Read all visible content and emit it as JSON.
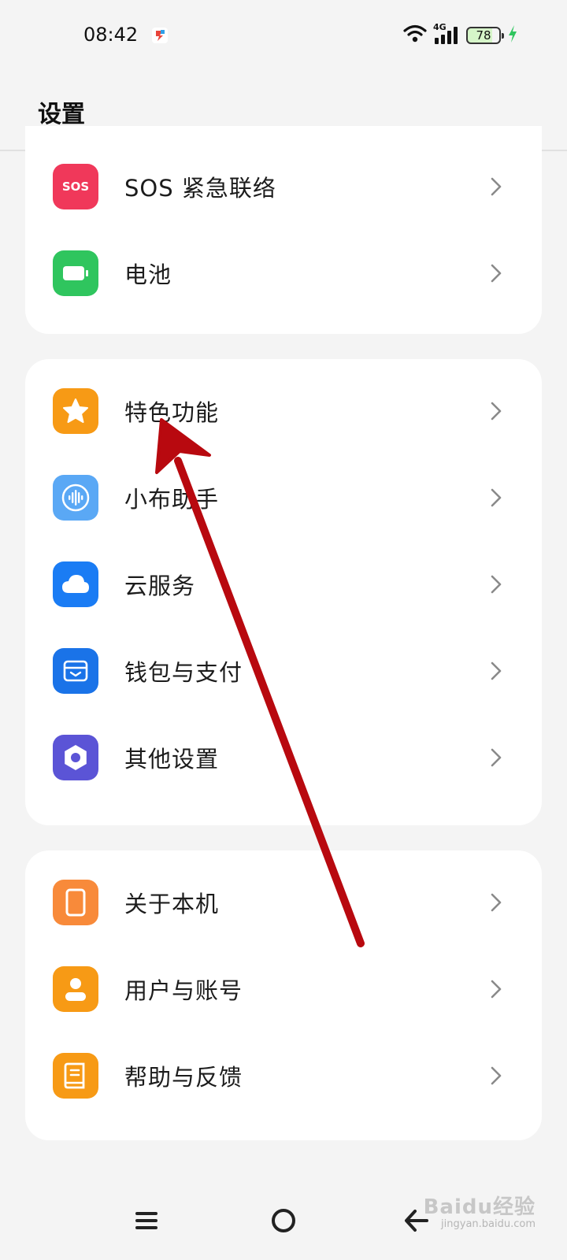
{
  "status_bar": {
    "time": "08:42",
    "network": "4G",
    "battery": "78",
    "charging": true
  },
  "header": {
    "title": "设置"
  },
  "sections": [
    {
      "items": [
        {
          "label": "SOS 紧急联络",
          "icon": "sos-icon",
          "icon_text": "SOS",
          "color": "#f0385a"
        },
        {
          "label": "电池",
          "icon": "battery-icon",
          "color": "#2fc55e"
        }
      ]
    },
    {
      "items": [
        {
          "label": "特色功能",
          "icon": "star-icon",
          "color": "#f79a15"
        },
        {
          "label": "小布助手",
          "icon": "voice-assistant-icon",
          "color": "#5aa8f5"
        },
        {
          "label": "云服务",
          "icon": "cloud-icon",
          "color": "#1a7cf4"
        },
        {
          "label": "钱包与支付",
          "icon": "wallet-icon",
          "color": "#1a73e8"
        },
        {
          "label": "其他设置",
          "icon": "gear-icon",
          "color": "#5b54d6"
        }
      ]
    },
    {
      "items": [
        {
          "label": "关于本机",
          "icon": "phone-icon",
          "color": "#f88a3a"
        },
        {
          "label": "用户与账号",
          "icon": "user-icon",
          "color": "#f79a15"
        },
        {
          "label": "帮助与反馈",
          "icon": "help-book-icon",
          "color": "#f79a15"
        }
      ]
    }
  ],
  "nav_bar": {
    "buttons": [
      "menu-icon",
      "home-circle-icon",
      "back-arrow-icon"
    ]
  },
  "watermark": {
    "logo": "Baidu经验",
    "url": "jingyan.baidu.com"
  },
  "annotation": {
    "color": "#b8090f"
  }
}
